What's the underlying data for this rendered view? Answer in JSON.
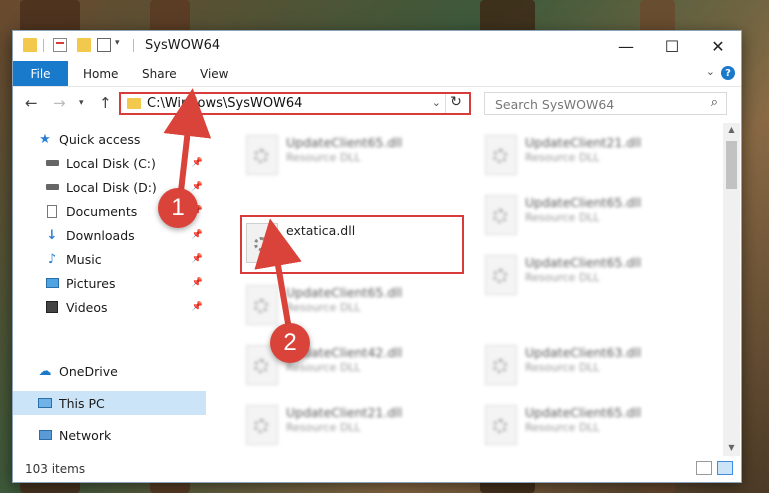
{
  "window": {
    "title": "SysWOW64",
    "controls": {
      "minimize": "—",
      "maximize": "☐",
      "close": "✕"
    }
  },
  "ribbon": {
    "tabs": [
      {
        "label": "File"
      },
      {
        "label": "Home"
      },
      {
        "label": "Share"
      },
      {
        "label": "View"
      }
    ],
    "help": "?"
  },
  "navigation": {
    "address_path": "C:\\Windows\\SysWOW64",
    "search_placeholder": "Search SysWOW64"
  },
  "sidebar": {
    "items": [
      {
        "label": "Quick access",
        "icon": "star-icon",
        "pinned": false
      },
      {
        "label": "Local Disk (C:)",
        "icon": "drive-icon",
        "pinned": true
      },
      {
        "label": "Local Disk (D:)",
        "icon": "drive-icon",
        "pinned": true
      },
      {
        "label": "Documents",
        "icon": "document-icon",
        "pinned": true
      },
      {
        "label": "Downloads",
        "icon": "download-icon",
        "pinned": true
      },
      {
        "label": "Music",
        "icon": "music-icon",
        "pinned": true
      },
      {
        "label": "Pictures",
        "icon": "picture-icon",
        "pinned": true
      },
      {
        "label": "Videos",
        "icon": "video-icon",
        "pinned": true
      },
      {
        "label": "OneDrive",
        "icon": "cloud-icon",
        "pinned": false
      },
      {
        "label": "This PC",
        "icon": "computer-icon",
        "pinned": false,
        "selected": true
      },
      {
        "label": "Network",
        "icon": "network-icon",
        "pinned": false
      }
    ]
  },
  "files": [
    {
      "name": "UpdateClient65.dll",
      "type": "Resource DLL"
    },
    {
      "name": "UpdateClient21.dll",
      "type": "Resource DLL"
    },
    {
      "name": "extatica.dll",
      "type": ""
    },
    {
      "name": "UpdateClient65.dll",
      "type": "Resource DLL"
    },
    {
      "name": "UpdateClient65.dll",
      "type": "Resource DLL"
    },
    {
      "name": "UpdateClient65.dll",
      "type": "Resource DLL"
    },
    {
      "name": "UpdateClient42.dll",
      "type": "Resource DLL"
    },
    {
      "name": "UpdateClient63.dll",
      "type": "Resource DLL"
    },
    {
      "name": "UpdateClient21.dll",
      "type": "Resource DLL"
    },
    {
      "name": "UpdateClient65.dll",
      "type": "Resource DLL"
    }
  ],
  "status": {
    "item_count": "103 items"
  },
  "annotations": {
    "step1": "1",
    "step2": "2",
    "color": "#d9433a"
  }
}
